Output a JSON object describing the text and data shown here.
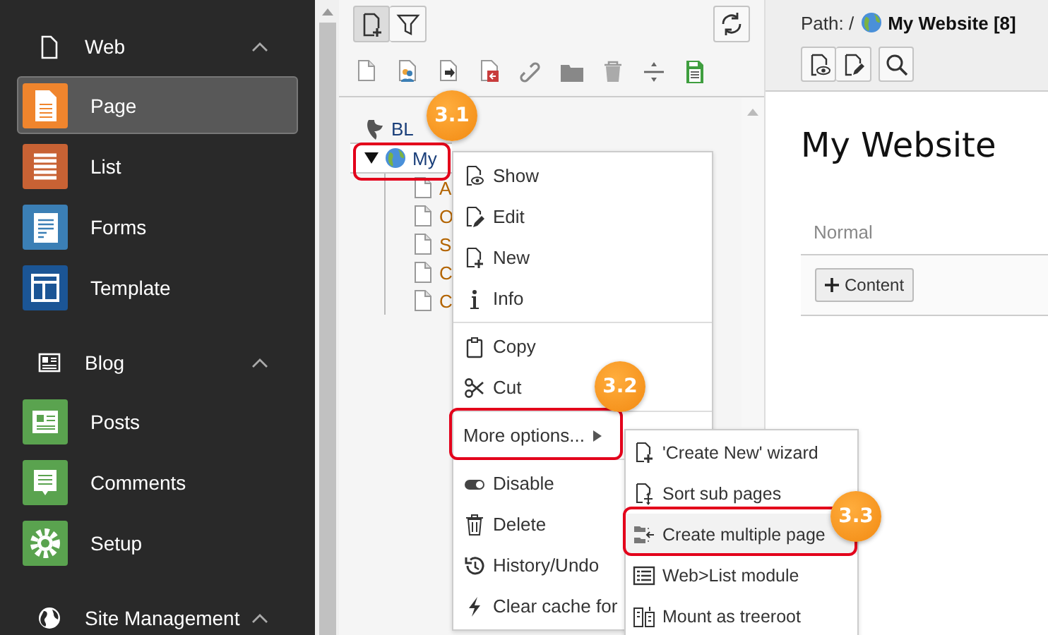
{
  "sidebar": {
    "groups": [
      {
        "label": "Web",
        "expanded": true,
        "items": [
          {
            "label": "Page",
            "selected": true,
            "color": "#f0852d"
          },
          {
            "label": "List",
            "selected": false,
            "color": "#c86234"
          },
          {
            "label": "Forms",
            "selected": false,
            "color": "#3b7fb5"
          },
          {
            "label": "Template",
            "selected": false,
            "color": "#1b5595"
          }
        ]
      },
      {
        "label": "Blog",
        "expanded": true,
        "items": [
          {
            "label": "Posts",
            "selected": false,
            "color": "#5aa34f"
          },
          {
            "label": "Comments",
            "selected": false,
            "color": "#5aa34f"
          },
          {
            "label": "Setup",
            "selected": false,
            "color": "#5aa34f"
          }
        ]
      },
      {
        "label": "Site Management",
        "expanded": true
      }
    ]
  },
  "page_tree": {
    "toolbar": {
      "buttons": [
        {
          "kind": "new-page",
          "selected": true
        },
        {
          "kind": "filter",
          "selected": false
        }
      ]
    },
    "tree": [
      {
        "label": "BL",
        "kind": "root",
        "selected": false,
        "children": [
          {
            "label": "My",
            "kind": "site",
            "selected": true,
            "expanded": true,
            "children": [
              {
                "label": "A",
                "kind": "page",
                "selected": false
              },
              {
                "label": "O",
                "kind": "page",
                "selected": false
              },
              {
                "label": "S",
                "kind": "page",
                "selected": false
              },
              {
                "label": "C",
                "kind": "page",
                "selected": false
              },
              {
                "label": "C",
                "kind": "page",
                "selected": false
              }
            ]
          }
        ]
      }
    ]
  },
  "context_menu": {
    "sections": [
      {
        "items": [
          {
            "label": "Show",
            "kind": "action"
          },
          {
            "label": "Edit",
            "kind": "action"
          },
          {
            "label": "New",
            "kind": "action"
          },
          {
            "label": "Info",
            "kind": "action"
          }
        ]
      },
      {
        "items": [
          {
            "label": "Copy",
            "kind": "action"
          },
          {
            "label": "Cut",
            "kind": "action"
          }
        ]
      },
      {
        "items": [
          {
            "label": "More options...",
            "kind": "submenu"
          }
        ]
      },
      {
        "items": [
          {
            "label": "Disable",
            "kind": "action"
          },
          {
            "label": "Delete",
            "kind": "action"
          },
          {
            "label": "History/Undo",
            "kind": "action"
          },
          {
            "label": "Clear cache for",
            "kind": "action"
          }
        ]
      }
    ]
  },
  "submenu": {
    "items": [
      {
        "label": "'Create New' wizard",
        "selected": false
      },
      {
        "label": "Sort sub pages",
        "selected": false
      },
      {
        "label": "Create multiple page",
        "selected": true
      },
      {
        "label": "Web>List module",
        "selected": false
      },
      {
        "label": "Mount as treeroot",
        "selected": false
      }
    ]
  },
  "annotations": [
    {
      "label": "3.1"
    },
    {
      "label": "3.2"
    },
    {
      "label": "3.3"
    }
  ],
  "doc_header": {
    "path_label": "Path: /",
    "path_page": "My Website [8]"
  },
  "content": {
    "title": "My Website",
    "column": "Normal",
    "add_button": "Content"
  }
}
